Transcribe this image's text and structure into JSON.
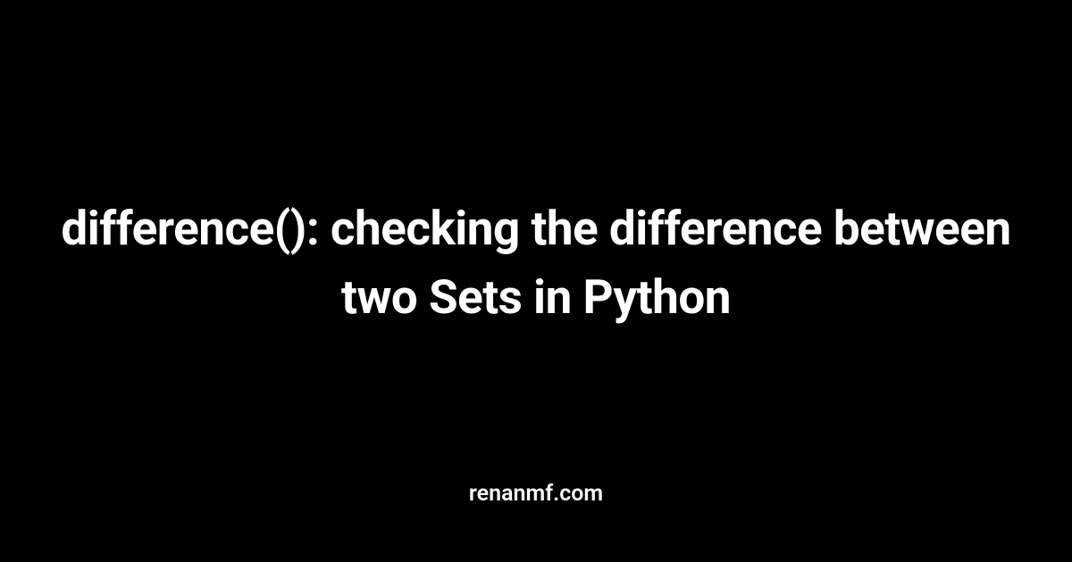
{
  "card": {
    "title": "difference(): checking the difference between two Sets in Python",
    "domain": "renanmf.com"
  }
}
